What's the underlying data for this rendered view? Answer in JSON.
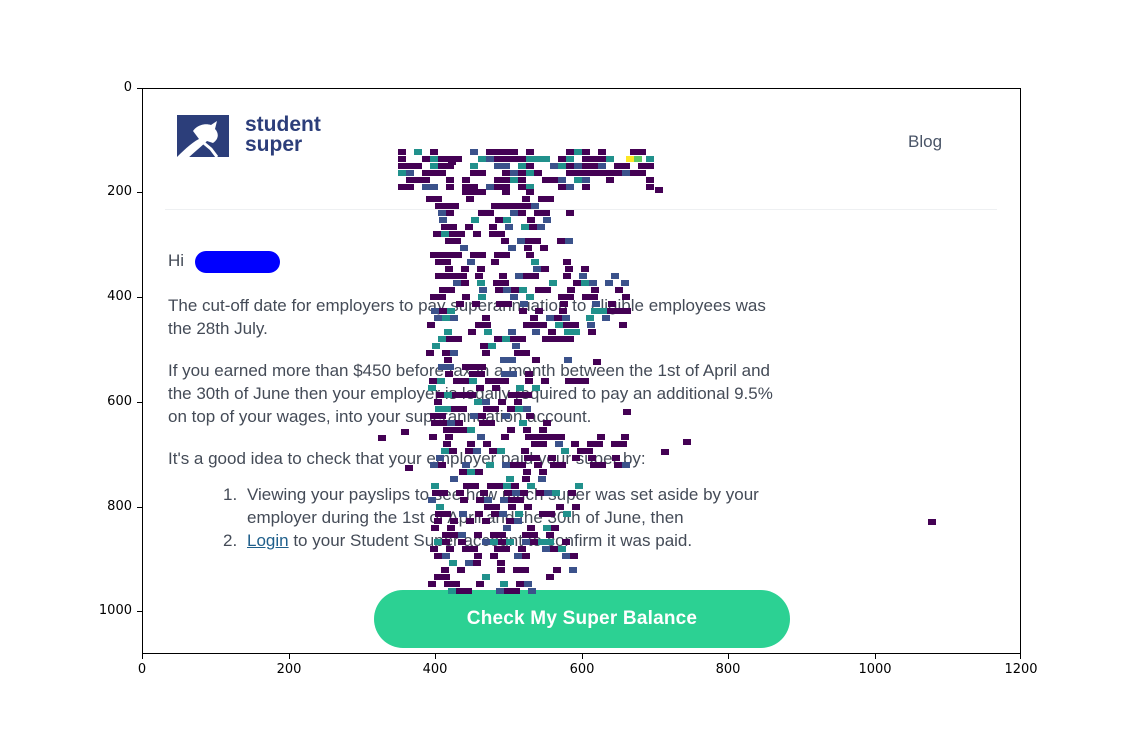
{
  "axes": {
    "x_ticks": [
      "0",
      "200",
      "400",
      "600",
      "800",
      "1000",
      "1200"
    ],
    "y_ticks": [
      "0",
      "200",
      "400",
      "600",
      "800",
      "1000"
    ]
  },
  "brand": {
    "name_line1": "student",
    "name_line2": "super",
    "logo_icon": "figure-icon",
    "color": "#2c3e7a"
  },
  "nav": {
    "blog_label": "Blog"
  },
  "email": {
    "greeting": "Hi",
    "paragraph1": [
      "The cut-off date for employers to pay superannuation to eligible employees was",
      "the 28th July."
    ],
    "paragraph2": [
      "If you earned more than $450 before tax in a month between the 1st of April and",
      "the 30th of June then your employer is legally required to pay an additional 9.5%",
      "on top of your wages, into your superannuation account."
    ],
    "paragraph3": "It's a good idea to check that your employer paid your super by:",
    "list": {
      "item1_num": "1.",
      "item1_line1": "Viewing your payslips to see how much super was set aside by your",
      "item1_line2": "employer during the 1st of April and the 30th of June, then",
      "item2_num": "2.",
      "item2_link": "Login",
      "item2_rest": " to your Student Super account to confirm it was paid."
    },
    "cta_label": "Check My Super Balance"
  },
  "colors": {
    "accent": "#2cd193",
    "redaction": "#0000ff",
    "overlay_dark": "#440154",
    "overlay_blue": "#3b528b",
    "overlay_teal": "#21918c",
    "overlay_green": "#5ec962",
    "overlay_yellow": "#fde725"
  }
}
